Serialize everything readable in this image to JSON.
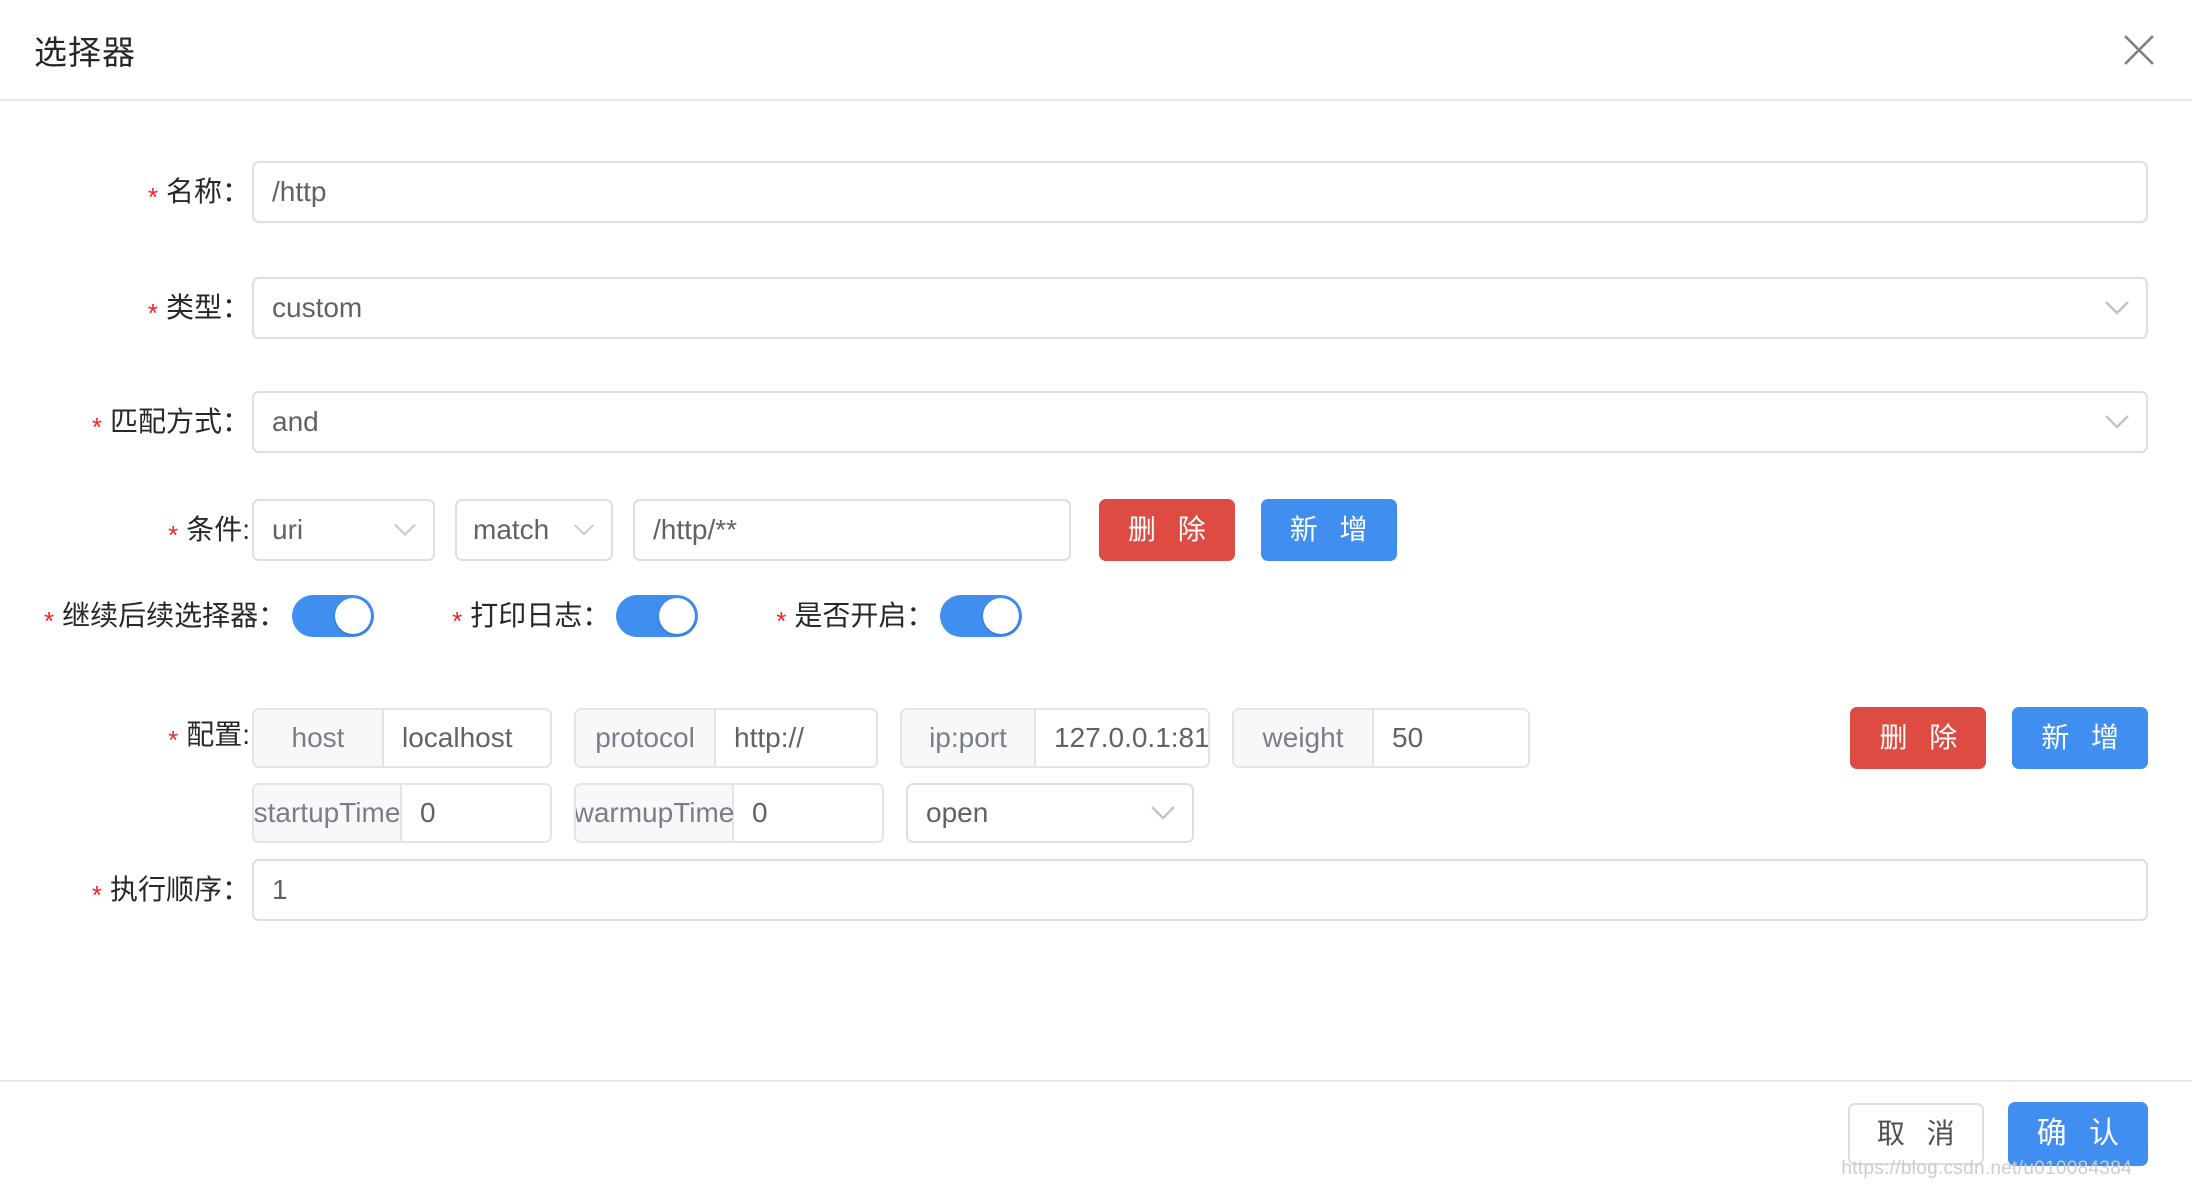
{
  "dialog": {
    "title": "选择器",
    "close_icon": "close-icon"
  },
  "form": {
    "name": {
      "label": "名称：",
      "required_mark": "*",
      "value": "/http"
    },
    "type": {
      "label": "类型：",
      "required_mark": "*",
      "value": "custom",
      "chevron": "chevron-down-icon"
    },
    "match_mode": {
      "label": "匹配方式：",
      "required_mark": "*",
      "value": "and",
      "chevron": "chevron-down-icon"
    },
    "condition": {
      "label": "条件:",
      "required_mark": "*",
      "field": "uri",
      "operator": "match",
      "value": "/http/**",
      "delete_label": "删 除",
      "add_label": "新 增"
    },
    "switches": [
      {
        "label": "继续后续选择器：",
        "required_mark": "*",
        "on": true
      },
      {
        "label": "打印日志：",
        "required_mark": "*",
        "on": true
      },
      {
        "label": "是否开启：",
        "required_mark": "*",
        "on": true
      }
    ],
    "config": {
      "label": "配置:",
      "required_mark": "*",
      "pairs_row1": [
        {
          "key": "host",
          "value": "localhost"
        },
        {
          "key": "protocol",
          "value": "http://"
        },
        {
          "key": "ip:port",
          "value": "127.0.0.1:81"
        },
        {
          "key": "weight",
          "value": "50"
        }
      ],
      "pairs_row2": [
        {
          "key": "startupTime",
          "value": "0"
        },
        {
          "key": "warmupTime",
          "value": "0"
        }
      ],
      "status_select": "open",
      "status_chevron": "chevron-down-icon",
      "delete_label": "删 除",
      "add_label": "新 增"
    },
    "order": {
      "label": "执行顺序：",
      "required_mark": "*",
      "value": "1"
    }
  },
  "footer": {
    "cancel_label": "取 消",
    "confirm_label": "确 认",
    "watermark": "https://blog.csdn.net/u010084384"
  },
  "colors": {
    "primary_blue": "#3f8ef0",
    "danger_red": "#dd4b42",
    "required_red": "#f5222d",
    "border_gray": "#dcdfe6",
    "text_dark": "#26282c"
  }
}
